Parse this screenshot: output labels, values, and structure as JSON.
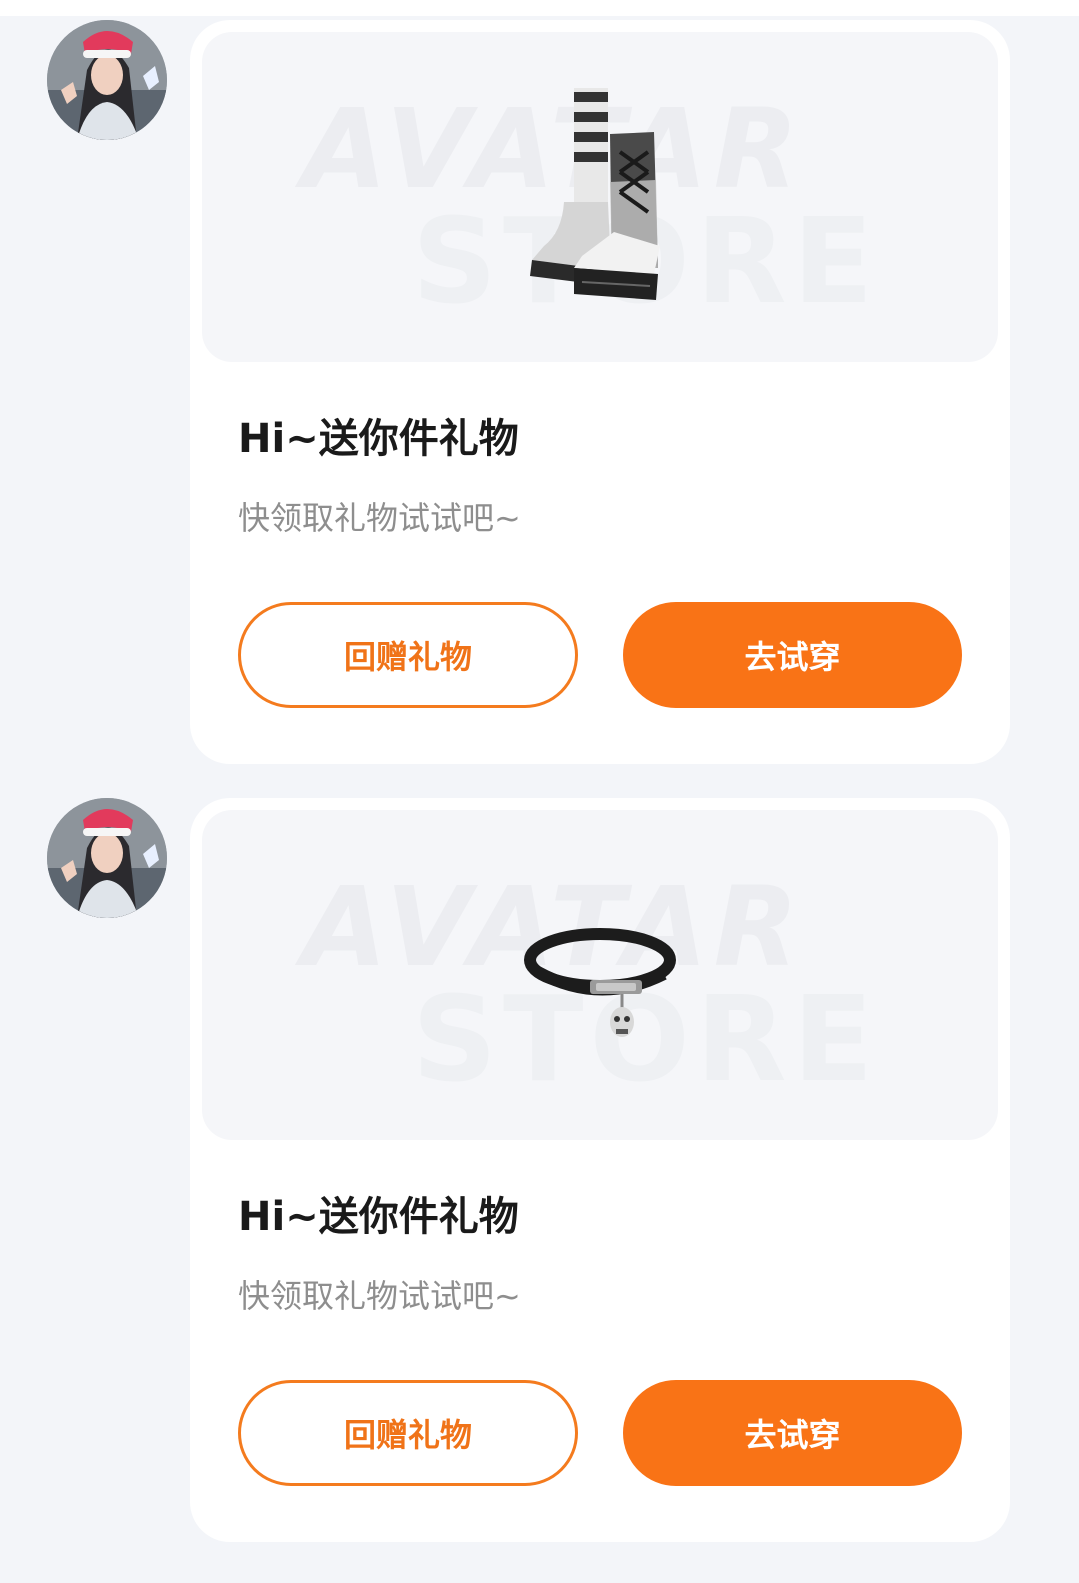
{
  "messages": [
    {
      "item_icon": "boots-icon",
      "watermark": {
        "line1": "AVATAR",
        "line2": "STORE"
      },
      "title": "Hi~送你件礼物",
      "subtitle": "快领取礼物试试吧~",
      "secondary_button": "回赠礼物",
      "primary_button": "去试穿"
    },
    {
      "item_icon": "choker-necklace-icon",
      "watermark": {
        "line1": "AVATAR",
        "line2": "STORE"
      },
      "title": "Hi~送你件礼物",
      "subtitle": "快领取礼物试试吧~",
      "secondary_button": "回赠礼物",
      "primary_button": "去试穿"
    }
  ],
  "colors": {
    "accent": "#f97316",
    "background": "#f3f5f9",
    "card": "#ffffff"
  }
}
